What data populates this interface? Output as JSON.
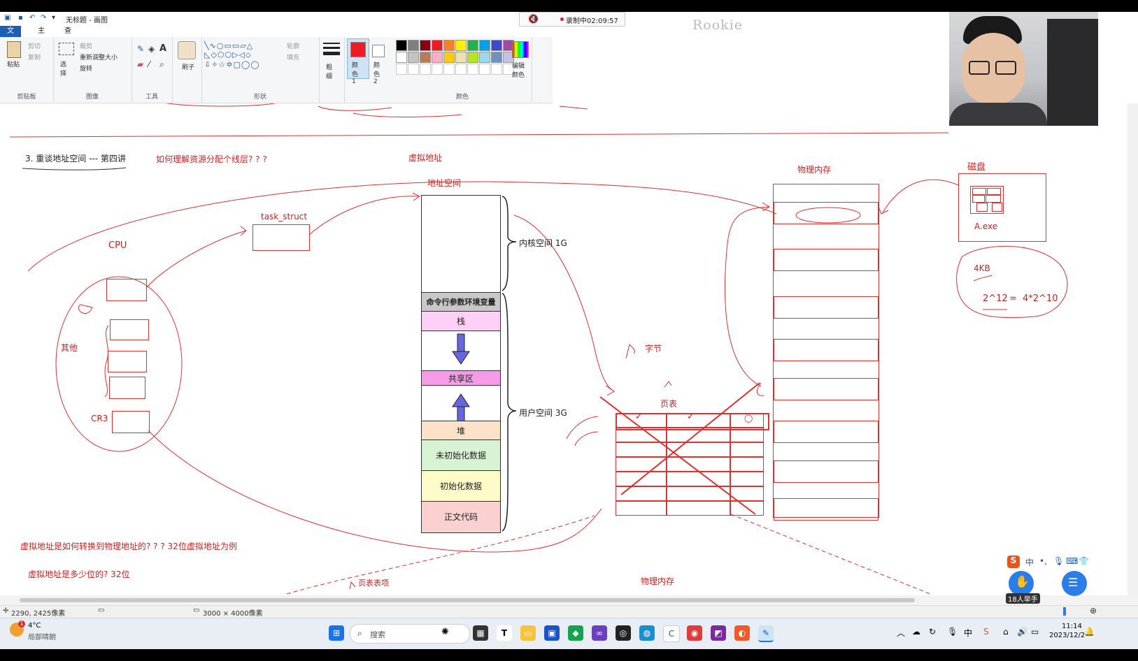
{
  "titlebar": {
    "title": "无标题 - 画图",
    "recording": "录制中02:09:57",
    "watermark": "Rookie"
  },
  "tabs": [
    "文件",
    "主页",
    "查看"
  ],
  "ribbon": {
    "clipboard": {
      "paste": "粘贴",
      "cut": "剪切",
      "copy": "复制",
      "label": "剪贴板"
    },
    "image": {
      "select": "选择",
      "crop": "裁剪",
      "resize": "重新调整大小",
      "rotate": "旋转",
      "label": "图像"
    },
    "tools": {
      "label": "工具",
      "brush": "刷子"
    },
    "shapes": {
      "outline": "轮廓",
      "fill": "填充",
      "label": "形状"
    },
    "size": "粗细",
    "color1": "颜色 1",
    "color2": "颜色 2",
    "colors_label": "颜色",
    "edit_colors": "编辑颜色",
    "palette": [
      "#000000",
      "#7f7f7f",
      "#880015",
      "#ed1c24",
      "#ff7f27",
      "#fff200",
      "#22b14c",
      "#00a2e8",
      "#3f48cc",
      "#a349a4",
      "#ffffff",
      "#c3c3c3",
      "#b97a57",
      "#ffaec9",
      "#ffc90e",
      "#efe4b0",
      "#b5e61d",
      "#99d9ea",
      "#7092be",
      "#c8bfe7"
    ]
  },
  "notes": {
    "heading": "3. 重谈地址空间 --- 第四讲",
    "question1": "如何理解资源分配个线层? ? ?",
    "virtual_addr": "虚拟地址",
    "addr_space": "地址空间",
    "physical_mem": "物理内存",
    "disk": "磁盘",
    "aexe": "A.exe",
    "kb": "4KB",
    "formula_a": "2^12",
    "formula_b": "4*2^10",
    "task_struct": "task_struct",
    "cpu": "CPU",
    "other": "其他",
    "cr3": "CR3",
    "kernel": "内核空间 1G",
    "user": "用户空间 3G",
    "byte": "字节",
    "page_table": "页表",
    "question2": "虚拟地址是如何转换到物理地址的? ? ?    32位虚拟地址为例",
    "question3": "虚拟地址是多少位的? 32位",
    "pte": "页表表项",
    "physical_mem2": "物理内存"
  },
  "segments": {
    "env": "命令行参数环境变量",
    "stack": "栈",
    "shared": "共享区",
    "heap": "堆",
    "bss": "未初始化数据",
    "data": "初始化数据",
    "text": "正文代码"
  },
  "status": {
    "cursor": "2290, 2425像素",
    "size": "3000 × 4000像素"
  },
  "taskbar": {
    "weather_temp": "4°C",
    "weather_desc": "局部晴朗",
    "search": "搜索",
    "time": "11:14",
    "date": "2023/12/2",
    "hands": "18人举手",
    "ime": "中"
  }
}
